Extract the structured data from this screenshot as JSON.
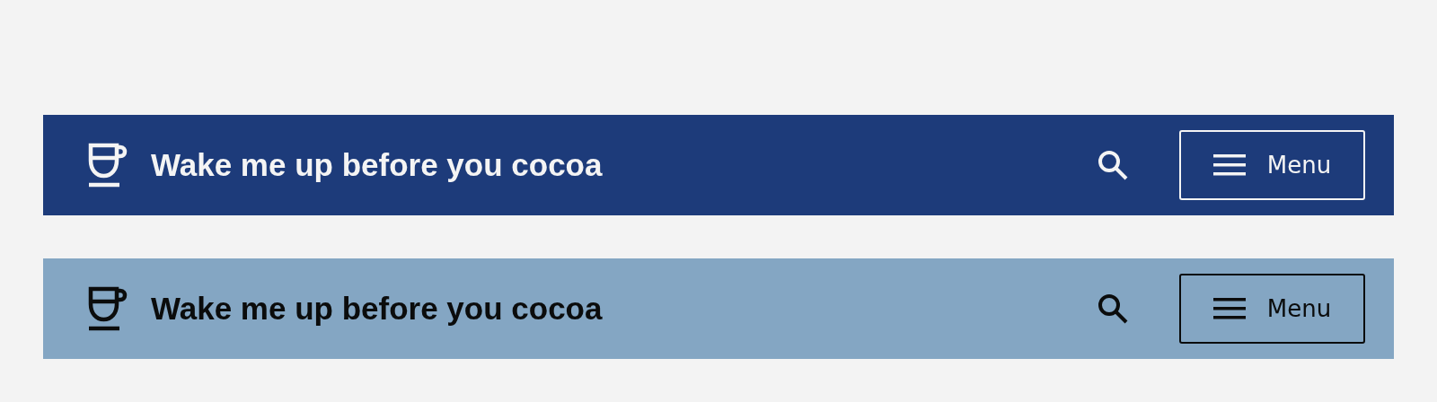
{
  "headers": [
    {
      "kind": "dark",
      "title": "Wake me up before you cocoa",
      "menu_label": "Menu"
    },
    {
      "kind": "light",
      "title": "Wake me up before you cocoa",
      "menu_label": "Menu"
    }
  ]
}
